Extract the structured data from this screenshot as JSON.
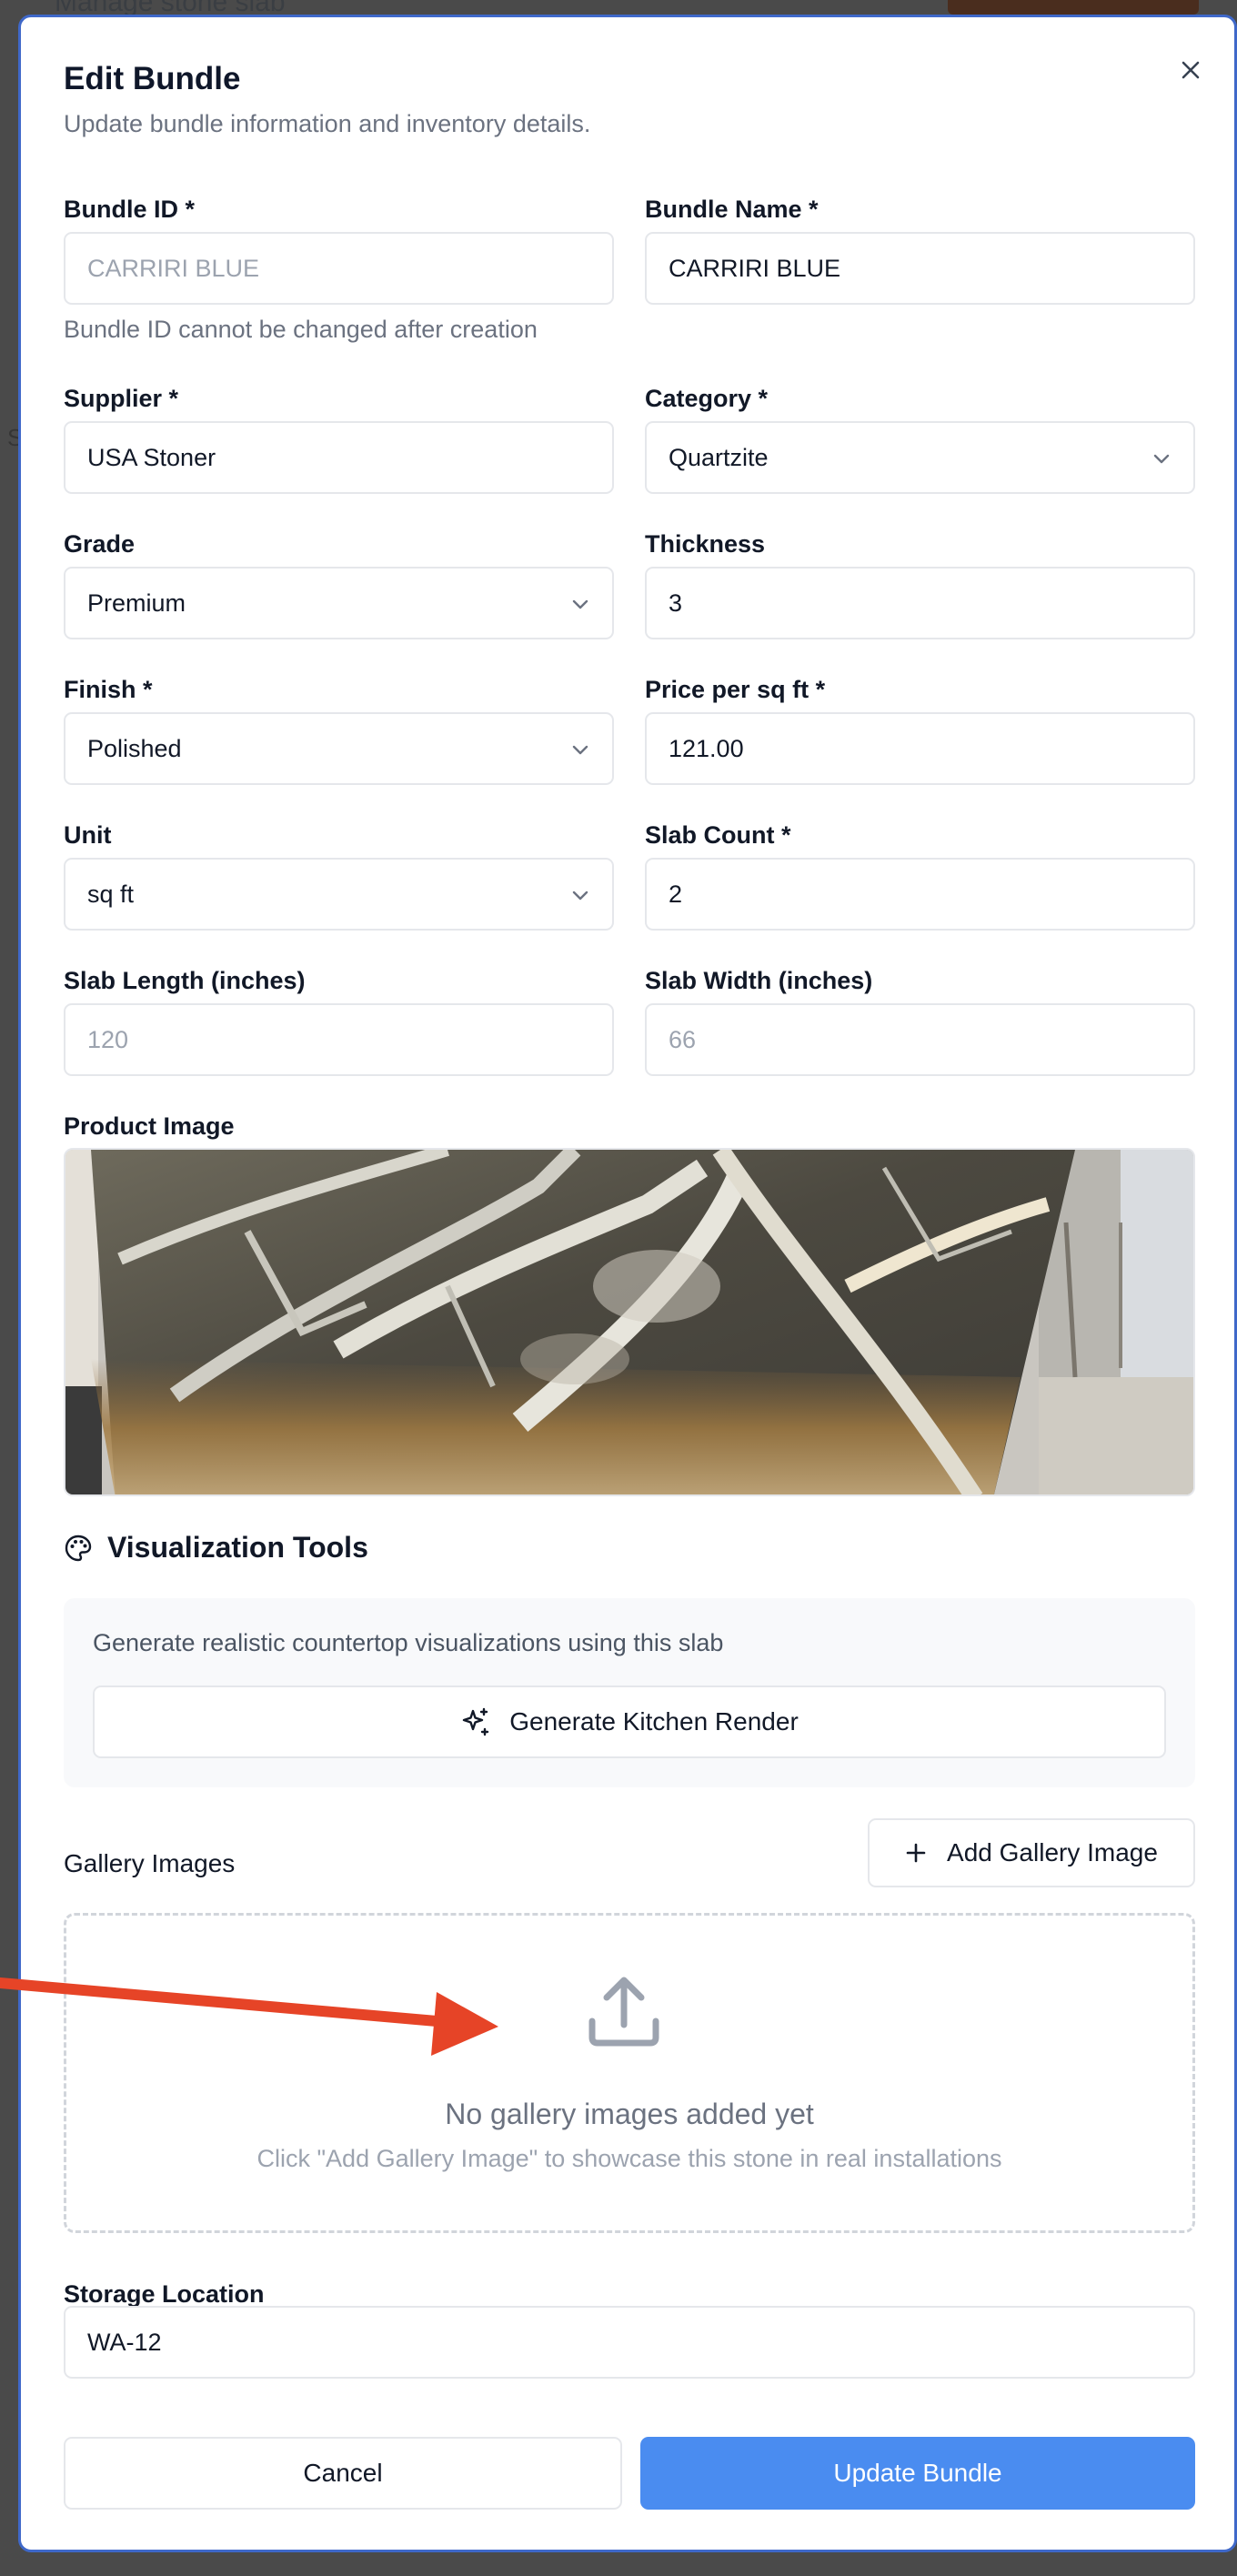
{
  "backdrop": {
    "title": "Manage stone slab",
    "side_letter": "S"
  },
  "dialog": {
    "title": "Edit Bundle",
    "subtitle": "Update bundle information and inventory details."
  },
  "fields": {
    "bundle_id": {
      "label": "Bundle ID *",
      "value": "CARRIRI BLUE",
      "help": "Bundle ID cannot be changed after creation"
    },
    "bundle_name": {
      "label": "Bundle Name *",
      "value": "CARRIRI BLUE"
    },
    "supplier": {
      "label": "Supplier *",
      "value": "USA Stoner"
    },
    "category": {
      "label": "Category *",
      "value": "Quartzite"
    },
    "grade": {
      "label": "Grade",
      "value": "Premium"
    },
    "thickness": {
      "label": "Thickness",
      "value": "3"
    },
    "finish": {
      "label": "Finish *",
      "value": "Polished"
    },
    "price": {
      "label": "Price per sq ft *",
      "value": "121.00"
    },
    "unit": {
      "label": "Unit",
      "value": "sq ft"
    },
    "slab_count": {
      "label": "Slab Count *",
      "value": "2"
    },
    "slab_length": {
      "label": "Slab Length (inches)",
      "placeholder": "120"
    },
    "slab_width": {
      "label": "Slab Width (inches)",
      "placeholder": "66"
    },
    "storage_location": {
      "label": "Storage Location",
      "value": "WA-12"
    }
  },
  "product_image": {
    "label": "Product Image"
  },
  "visualization": {
    "title": "Visualization Tools",
    "description": "Generate realistic countertop visualizations using this slab",
    "button": "Generate Kitchen Render"
  },
  "gallery": {
    "label": "Gallery Images",
    "add_button": "Add Gallery Image",
    "empty_title": "No gallery images added yet",
    "empty_hint": "Click \"Add Gallery Image\" to showcase this stone in real installations"
  },
  "actions": {
    "cancel": "Cancel",
    "update": "Update Bundle"
  },
  "colors": {
    "primary": "#4a8cf0",
    "dialog_border": "#3f68c9",
    "arrow": "#e64427"
  }
}
